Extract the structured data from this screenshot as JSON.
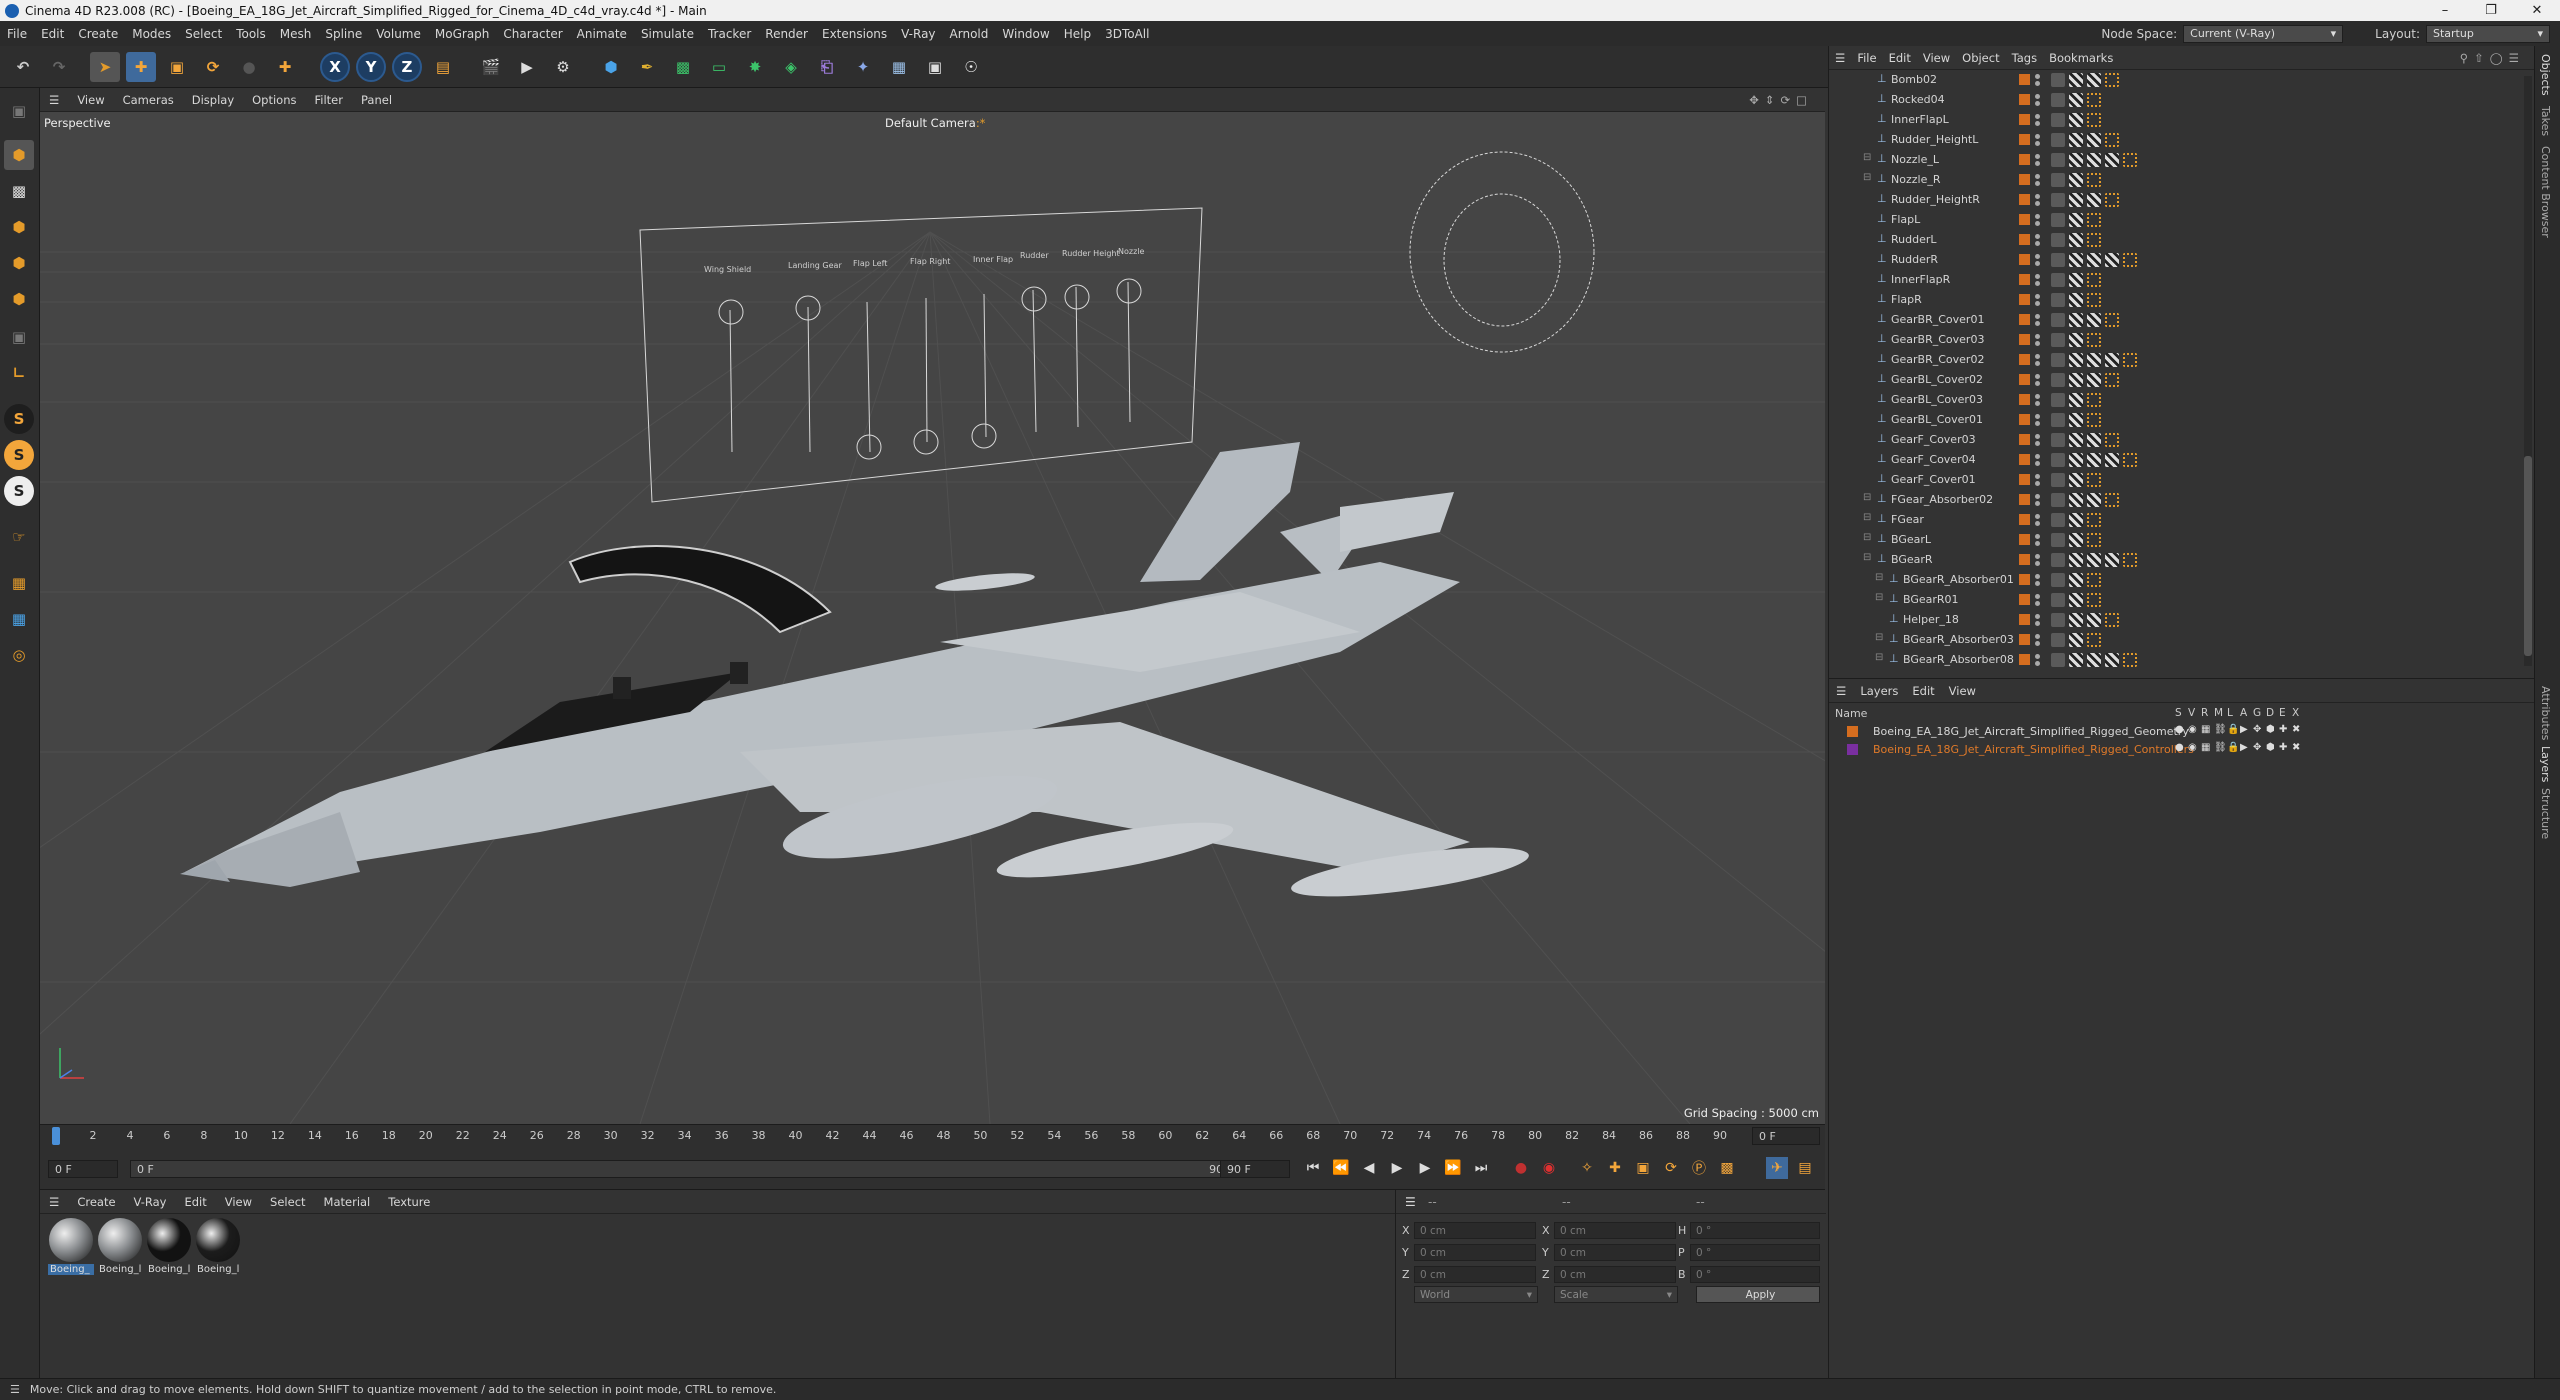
{
  "window": {
    "title": "Cinema 4D R23.008 (RC) - [Boeing_EA_18G_Jet_Aircraft_Simplified_Rigged_for_Cinema_4D_c4d_vray.c4d *] - Main"
  },
  "menubar": {
    "items": [
      "File",
      "Edit",
      "Create",
      "Modes",
      "Select",
      "Tools",
      "Mesh",
      "Spline",
      "Volume",
      "MoGraph",
      "Character",
      "Animate",
      "Simulate",
      "Tracker",
      "Render",
      "Extensions",
      "V-Ray",
      "Arnold",
      "Window",
      "Help",
      "3DToAll"
    ],
    "node_space_label": "Node Space:",
    "node_space_value": "Current (V-Ray)",
    "layout_label": "Layout:",
    "layout_value": "Startup"
  },
  "toolbar": {
    "axis_x": "X",
    "axis_y": "Y",
    "axis_z": "Z"
  },
  "left_tools": {
    "s1": "S",
    "s2": "S",
    "s3": "S"
  },
  "viewport": {
    "menu": [
      "View",
      "Cameras",
      "Display",
      "Options",
      "Filter",
      "Panel"
    ],
    "projection": "Perspective",
    "camera": "Default Camera",
    "camera_mark": ":*",
    "grid_spacing": "Grid Spacing : 5000 cm",
    "controller_labels": [
      "Wing Shield",
      "Landing Gear",
      "Flap Left",
      "Flap Right",
      "Inner Flap",
      "Rudder",
      "Rudder Height",
      "Nozzle"
    ]
  },
  "timeline": {
    "ticks": [
      "0",
      "2",
      "4",
      "6",
      "8",
      "10",
      "12",
      "14",
      "16",
      "18",
      "20",
      "22",
      "24",
      "26",
      "28",
      "30",
      "32",
      "34",
      "36",
      "38",
      "40",
      "42",
      "44",
      "46",
      "48",
      "50",
      "52",
      "54",
      "56",
      "58",
      "60",
      "62",
      "64",
      "66",
      "68",
      "70",
      "72",
      "74",
      "76",
      "78",
      "80",
      "82",
      "84",
      "86",
      "88",
      "90"
    ],
    "current_frame": "0 F"
  },
  "playbar": {
    "start": "0 F",
    "current": "0 F",
    "end_a": "90 F",
    "end_b": "90 F"
  },
  "materials": {
    "menu": [
      "Create",
      "V-Ray",
      "Edit",
      "View",
      "Select",
      "Material",
      "Texture"
    ],
    "items": [
      {
        "label": "Boeing_",
        "color": "#8a8d90"
      },
      {
        "label": "Boeing_l",
        "color": "#8a8d90"
      },
      {
        "label": "Boeing_l",
        "color": "#121212"
      },
      {
        "label": "Boeing_l",
        "color": "#1c1c1c"
      }
    ]
  },
  "coords": {
    "header_a": "--",
    "header_b": "--",
    "header_c": "--",
    "rows": [
      {
        "l1": "X",
        "v1": "0 cm",
        "l2": "X",
        "v2": "0 cm",
        "l3": "H",
        "v3": "0 °"
      },
      {
        "l1": "Y",
        "v1": "0 cm",
        "l2": "Y",
        "v2": "0 cm",
        "l3": "P",
        "v3": "0 °"
      },
      {
        "l1": "Z",
        "v1": "0 cm",
        "l2": "Z",
        "v2": "0 cm",
        "l3": "B",
        "v3": "0 °"
      }
    ],
    "space": "World",
    "mode": "Scale",
    "apply": "Apply"
  },
  "status": {
    "text": "Move: Click and drag to move elements. Hold down SHIFT to quantize movement / add to the selection in point mode, CTRL to remove."
  },
  "object_manager": {
    "menu": [
      "File",
      "Edit",
      "View",
      "Object",
      "Tags",
      "Bookmarks"
    ],
    "rows": [
      {
        "name": "Bomb02",
        "indent": 1,
        "expand": false
      },
      {
        "name": "Rocked04",
        "indent": 1,
        "expand": false
      },
      {
        "name": "InnerFlapL",
        "indent": 1,
        "expand": false
      },
      {
        "name": "Rudder_HeightL",
        "indent": 1,
        "expand": false
      },
      {
        "name": "Nozzle_L",
        "indent": 1,
        "expand": true
      },
      {
        "name": "Nozzle_R",
        "indent": 1,
        "expand": true
      },
      {
        "name": "Rudder_HeightR",
        "indent": 1,
        "expand": false
      },
      {
        "name": "FlapL",
        "indent": 1,
        "expand": false
      },
      {
        "name": "RudderL",
        "indent": 1,
        "expand": false
      },
      {
        "name": "RudderR",
        "indent": 1,
        "expand": false
      },
      {
        "name": "InnerFlapR",
        "indent": 1,
        "expand": false
      },
      {
        "name": "FlapR",
        "indent": 1,
        "expand": false
      },
      {
        "name": "GearBR_Cover01",
        "indent": 1,
        "expand": false
      },
      {
        "name": "GearBR_Cover03",
        "indent": 1,
        "expand": false
      },
      {
        "name": "GearBR_Cover02",
        "indent": 1,
        "expand": false
      },
      {
        "name": "GearBL_Cover02",
        "indent": 1,
        "expand": false
      },
      {
        "name": "GearBL_Cover03",
        "indent": 1,
        "expand": false
      },
      {
        "name": "GearBL_Cover01",
        "indent": 1,
        "expand": false
      },
      {
        "name": "GearF_Cover03",
        "indent": 1,
        "expand": false
      },
      {
        "name": "GearF_Cover04",
        "indent": 1,
        "expand": false
      },
      {
        "name": "GearF_Cover01",
        "indent": 1,
        "expand": false
      },
      {
        "name": "FGear_Absorber02",
        "indent": 1,
        "expand": true
      },
      {
        "name": "FGear",
        "indent": 1,
        "expand": true
      },
      {
        "name": "BGearL",
        "indent": 1,
        "expand": true
      },
      {
        "name": "BGearR",
        "indent": 1,
        "expand": true
      },
      {
        "name": "BGearR_Absorber01",
        "indent": 2,
        "expand": true
      },
      {
        "name": "BGearR01",
        "indent": 2,
        "expand": true
      },
      {
        "name": "Helper_18",
        "indent": 2,
        "expand": false
      },
      {
        "name": "BGearR_Absorber03",
        "indent": 2,
        "expand": true
      },
      {
        "name": "BGearR_Absorber08",
        "indent": 2,
        "expand": true
      }
    ]
  },
  "layer_manager": {
    "menu": [
      "Layers",
      "Edit",
      "View"
    ],
    "col_name": "Name",
    "cols": [
      "S",
      "V",
      "R",
      "M",
      "L",
      "A",
      "G",
      "D",
      "E",
      "X"
    ],
    "layers": [
      {
        "name": "Boeing_EA_18G_Jet_Aircraft_Simplified_Rigged_Geometry",
        "color": "#d56d1f",
        "text_color": "#d8d8d8"
      },
      {
        "name": "Boeing_EA_18G_Jet_Aircraft_Simplified_Rigged_Controllers",
        "color": "#7a2fa0",
        "text_color": "#e07a2a"
      }
    ]
  },
  "side_tabs": [
    "Objects",
    "Takes",
    "Content Browser",
    "Attributes",
    "Layers",
    "Structure"
  ]
}
